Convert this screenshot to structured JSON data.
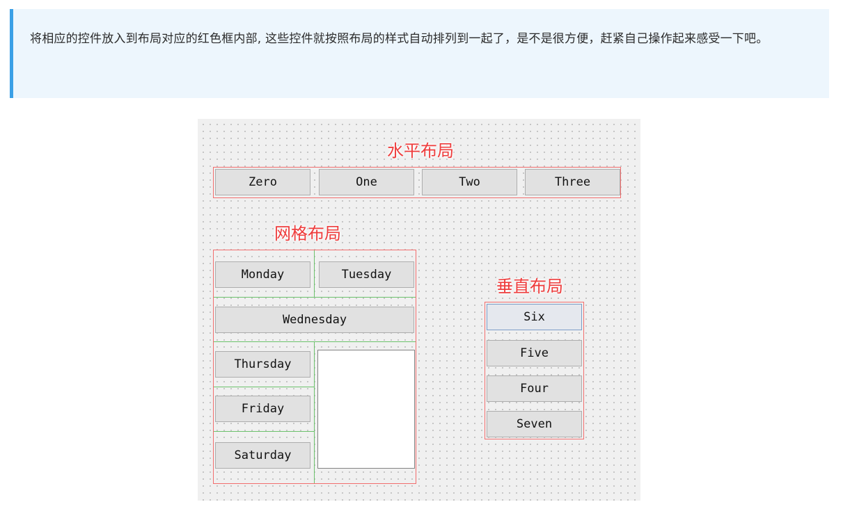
{
  "note": {
    "text": "将相应的控件放入到布局对应的红色框内部, 这些控件就按照布局的样式自动排列到一起了，是不是很方便，赶紧自己操作起来感受一下吧。"
  },
  "colors": {
    "layout_frame": "#f26d6d",
    "layout_label": "#ee3c3c",
    "grid_divider": "#6cc26c",
    "note_background": "#edf6fd",
    "note_accent": "#3ba0e6"
  },
  "horizontal_layout": {
    "label": "水平布局",
    "buttons": [
      "Zero",
      "One",
      "Two",
      "Three"
    ]
  },
  "grid_layout": {
    "label": "网格布局",
    "buttons": {
      "monday": "Monday",
      "tuesday": "Tuesday",
      "wednesday": "Wednesday",
      "thursday": "Thursday",
      "friday": "Friday",
      "saturday": "Saturday"
    }
  },
  "vertical_layout": {
    "label": "垂直布局",
    "buttons": [
      "Six",
      "Five",
      "Four",
      "Seven"
    ]
  }
}
